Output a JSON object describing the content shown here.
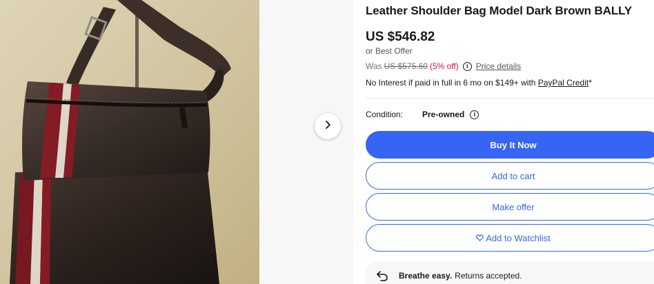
{
  "product": {
    "title": "Leather Shoulder Bag Model Dark Brown BALLY",
    "price": "US $546.82",
    "best_offer": "or Best Offer",
    "was_label": "Was",
    "was_price": "US $575.60",
    "percent_off": "(5% off)",
    "price_details_link": "Price details",
    "paypal_text": "No Interest if paid in full in 6 mo on $149+ with",
    "paypal_link": "PayPal Credit",
    "paypal_suffix": "*",
    "condition_label": "Condition:",
    "condition_value": "Pre-owned"
  },
  "buttons": {
    "buy_now": "Buy It Now",
    "add_to_cart": "Add to cart",
    "make_offer": "Make offer",
    "watchlist": "Add to Watchlist"
  },
  "returns": {
    "bold": "Breathe easy.",
    "text": "Returns accepted."
  },
  "icons": {
    "next": "chevron-right-icon",
    "info": "info-icon",
    "heart": "heart-icon",
    "returns": "return-arrow-icon"
  },
  "colors": {
    "accent": "#3665f3",
    "discount": "#e0103a"
  }
}
